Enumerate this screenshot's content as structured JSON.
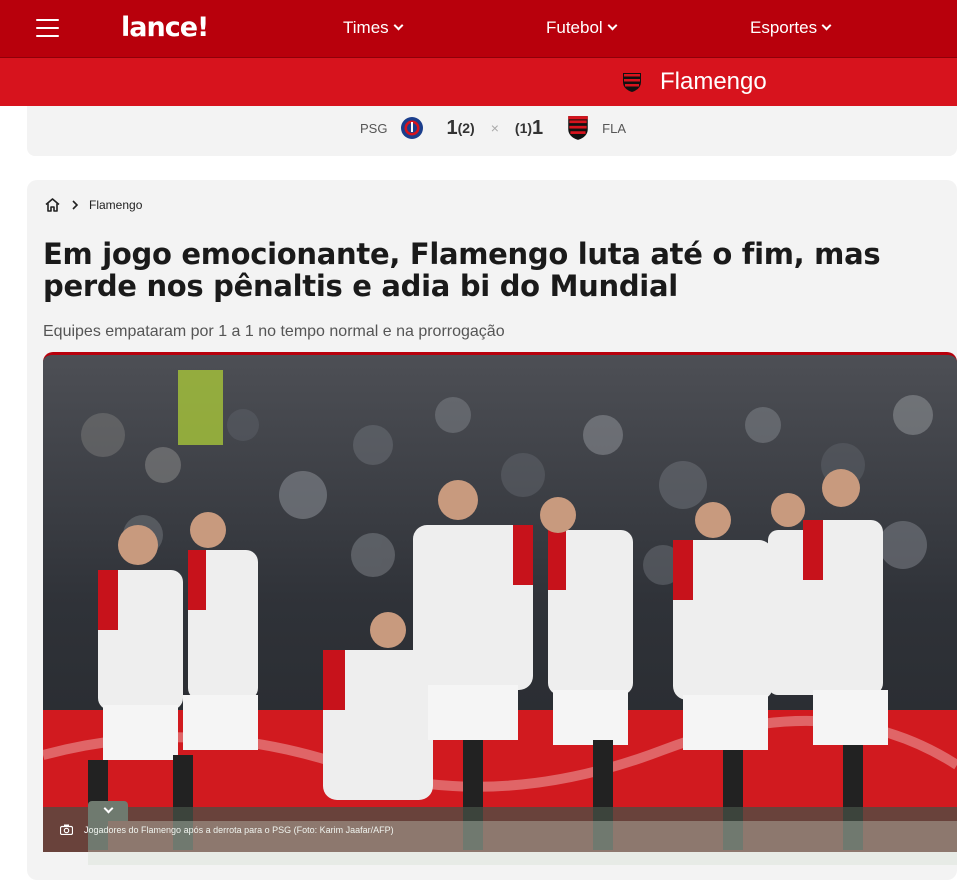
{
  "header": {
    "logo_text": "lance!",
    "nav": [
      {
        "label": "Times"
      },
      {
        "label": "Futebol"
      },
      {
        "label": "Esportes"
      }
    ]
  },
  "team_bar": {
    "team_name": "Flamengo"
  },
  "score": {
    "home_abbr": "PSG",
    "home_goals": "1",
    "home_penalties": "(2)",
    "separator": "×",
    "away_penalties": "(1)",
    "away_goals": "1",
    "away_abbr": "FLA"
  },
  "article": {
    "breadcrumb": "Flamengo",
    "headline": "Em jogo emocionante, Flamengo luta até o fim, mas perde nos pênaltis e adia bi do Mundial",
    "subtitle": "Equipes empataram por 1 a 1 no tempo normal e na prorrogação",
    "photo_caption": "Jogadores do Flamengo após a derrota para o PSG (Foto: Karim Jaafar/AFP)"
  },
  "colors": {
    "brand_red": "#b8000c",
    "team_red": "#d7131d"
  },
  "icons": [
    "menu-icon",
    "chevron-down-icon",
    "flamengo-crest-icon",
    "psg-crest-icon",
    "home-icon",
    "chevron-right-icon",
    "camera-icon"
  ]
}
